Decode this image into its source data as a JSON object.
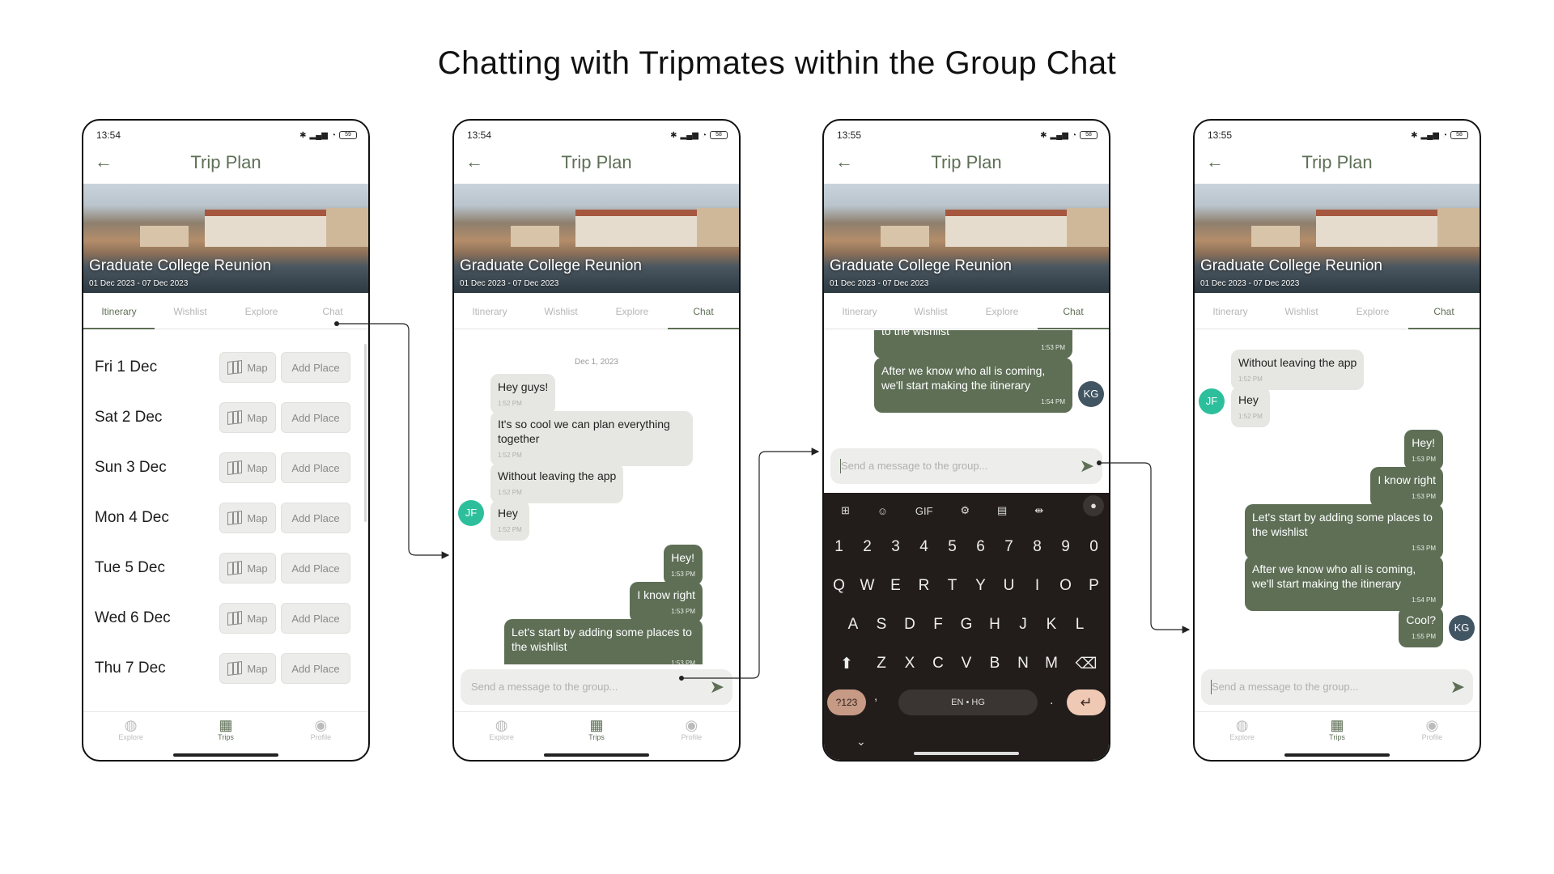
{
  "page_title": "Chatting with Tripmates within the Group Chat",
  "colors": {
    "accent": "#5e6f56",
    "incoming_bubble": "#e6e6e2",
    "avatar_jf": "#2dbf9c",
    "avatar_kg": "#425563",
    "keyboard_bg": "#221d1b"
  },
  "common": {
    "header_title": "Trip Plan",
    "back_icon": "arrow-left-icon",
    "trip_name": "Graduate College Reunion",
    "trip_dates": "01 Dec 2023 - 07 Dec 2023",
    "tabs": [
      "Itinerary",
      "Wishlist",
      "Explore",
      "Chat"
    ],
    "nav": [
      "Explore",
      "Trips",
      "Profile"
    ],
    "input_placeholder": "Send a message to the group..."
  },
  "screens": [
    {
      "time": "13:54",
      "battery": "59",
      "active_tab": "Itinerary"
    },
    {
      "time": "13:54",
      "battery": "58",
      "active_tab": "Chat"
    },
    {
      "time": "13:55",
      "battery": "58",
      "active_tab": "Chat"
    },
    {
      "time": "13:55",
      "battery": "58",
      "active_tab": "Chat"
    }
  ],
  "itinerary": {
    "days": [
      "Fri 1 Dec",
      "Sat 2 Dec",
      "Sun 3 Dec",
      "Mon 4 Dec",
      "Tue 5 Dec",
      "Wed 6 Dec",
      "Thu 7 Dec"
    ],
    "map_label": "Map",
    "add_place_label": "Add Place"
  },
  "chat2": {
    "date": "Dec 1, 2023",
    "messages": [
      {
        "text": "Hey guys!",
        "time": "1:52 PM"
      },
      {
        "text": "It's so cool we can plan everything together",
        "time": "1:52 PM"
      },
      {
        "text": "Without leaving the app",
        "time": "1:52 PM"
      },
      {
        "text": "Hey",
        "time": "1:52 PM",
        "avatar": "JF"
      },
      {
        "text": "Hey!",
        "time": "1:53 PM"
      },
      {
        "text": "I know right",
        "time": "1:53 PM"
      },
      {
        "text": "Let's start by adding some places to the wishlist",
        "time": "1:53 PM"
      }
    ]
  },
  "chat3": {
    "messages": [
      {
        "text": "to the wishlist",
        "time": "1:53 PM"
      },
      {
        "text": "After we know who all is coming, we'll start making the itinerary",
        "time": "1:54 PM",
        "avatar": "KG"
      }
    ],
    "keyboard": {
      "top": [
        "grid-icon",
        "sticker-icon",
        "GIF",
        "gear-icon",
        "clipboard-icon",
        "cursor-icon",
        "mic-icon"
      ],
      "numbers": [
        "1",
        "2",
        "3",
        "4",
        "5",
        "6",
        "7",
        "8",
        "9",
        "0"
      ],
      "row1": [
        "Q",
        "W",
        "E",
        "R",
        "T",
        "Y",
        "U",
        "I",
        "O",
        "P"
      ],
      "row2": [
        "A",
        "S",
        "D",
        "F",
        "G",
        "H",
        "J",
        "K",
        "L"
      ],
      "row3": [
        "Z",
        "X",
        "C",
        "V",
        "B",
        "N",
        "M"
      ],
      "symbols_key": "?123",
      "comma": ",",
      "lang": "EN • HG",
      "period": "."
    }
  },
  "chat4": {
    "messages": [
      {
        "text": "Without leaving the app",
        "time": "1:52 PM"
      },
      {
        "text": "Hey",
        "time": "1:52 PM",
        "avatar": "JF"
      },
      {
        "text": "Hey!",
        "time": "1:53 PM"
      },
      {
        "text": "I know right",
        "time": "1:53 PM"
      },
      {
        "text": "Let's start by adding some places to the wishlist",
        "time": "1:53 PM"
      },
      {
        "text": "After we know who all is coming, we'll start making the itinerary",
        "time": "1:54 PM"
      },
      {
        "text": "Cool?",
        "time": "1:55 PM",
        "avatar": "KG"
      }
    ]
  }
}
